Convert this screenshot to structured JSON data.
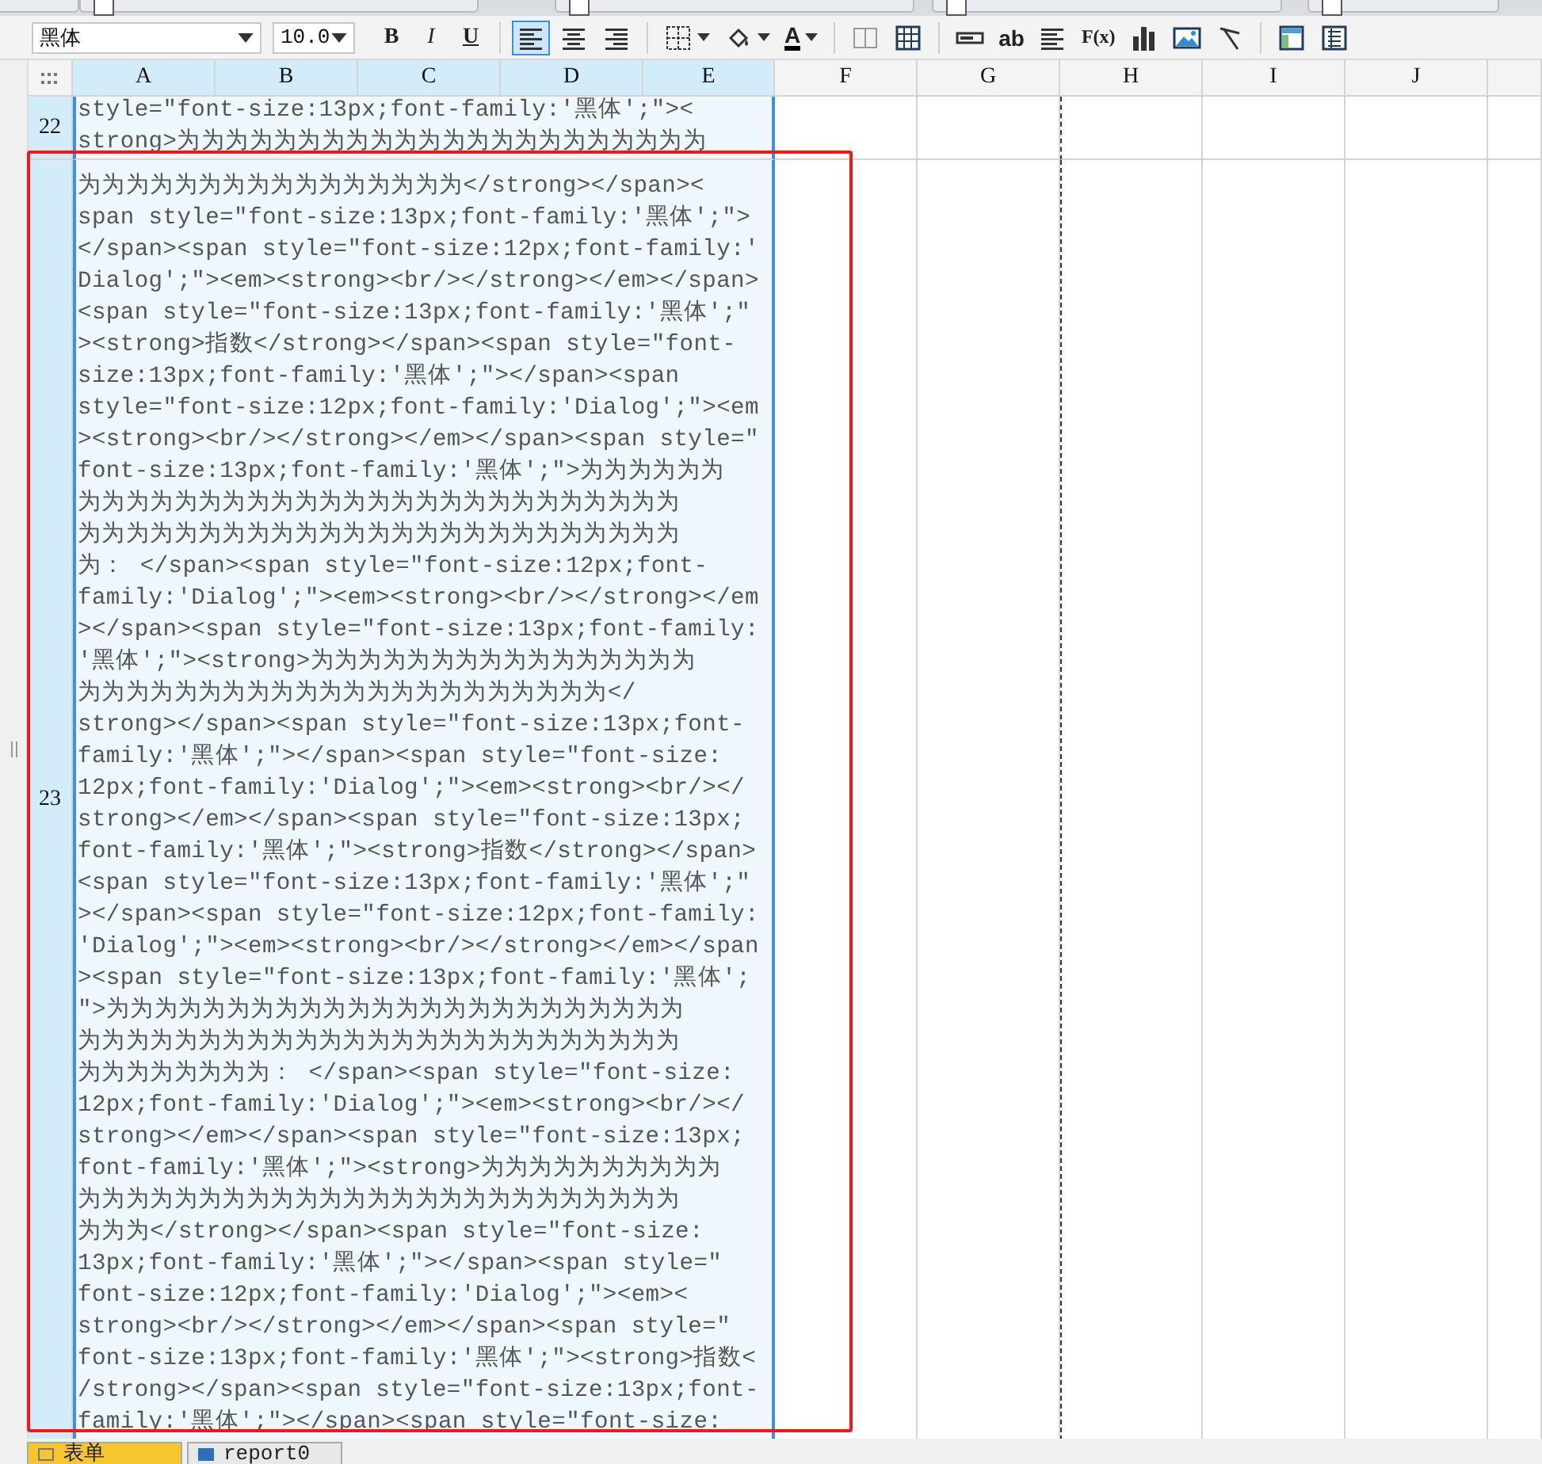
{
  "toolbar": {
    "font": "黑体",
    "size": "10.0",
    "buttons": [
      {
        "kind": "bold",
        "label": "B"
      },
      {
        "kind": "italic",
        "label": "I"
      },
      {
        "kind": "underline",
        "label": "U"
      },
      {
        "kind": "separator"
      },
      {
        "kind": "align-left",
        "selected": true
      },
      {
        "kind": "align-center",
        "selected": false
      },
      {
        "kind": "align-right",
        "selected": false
      },
      {
        "kind": "separator"
      },
      {
        "kind": "border"
      },
      {
        "kind": "fill-color"
      },
      {
        "kind": "font-color",
        "label": "A"
      },
      {
        "kind": "separator"
      },
      {
        "kind": "frame"
      },
      {
        "kind": "table"
      },
      {
        "kind": "separator"
      },
      {
        "kind": "textbox"
      },
      {
        "kind": "text-label",
        "label": "ab"
      },
      {
        "kind": "paragraph"
      },
      {
        "kind": "formula",
        "label": "F(x)"
      },
      {
        "kind": "bar-chart"
      },
      {
        "kind": "image"
      },
      {
        "kind": "slash"
      },
      {
        "kind": "separator"
      },
      {
        "kind": "form"
      },
      {
        "kind": "list-form"
      }
    ]
  },
  "sheet": {
    "columns": [
      {
        "label": "A",
        "selected": true
      },
      {
        "label": "B",
        "selected": true
      },
      {
        "label": "C",
        "selected": true
      },
      {
        "label": "D",
        "selected": true
      },
      {
        "label": "E",
        "selected": true
      },
      {
        "label": "F",
        "selected": false,
        "page_break": false
      },
      {
        "label": "G",
        "selected": false,
        "page_break": false
      },
      {
        "label": "H",
        "selected": false,
        "page_break": true
      },
      {
        "label": "I",
        "selected": false,
        "page_break": false
      },
      {
        "label": "J",
        "selected": false,
        "page_break": false
      }
    ],
    "rows": [
      {
        "number": "22",
        "selected": true,
        "lines": [
          "style=\"font-size:13px;font-family:'黑体';\"><",
          "strong>为为为为为为为为为为为为为为为为为为为为为为"
        ]
      },
      {
        "number": "23",
        "selected": true,
        "lines": [
          "为为为为为为为为为为为为为为为为</strong></span><",
          "span style=\"font-size:13px;font-family:'黑体';\">",
          "</span><span style=\"font-size:12px;font-family:'",
          "Dialog';\"><em><strong><br/></strong></em></span>",
          "<span style=\"font-size:13px;font-family:'黑体';\"",
          "><strong>指数</strong></span><span style=\"font-",
          "size:13px;font-family:'黑体';\"></span><span",
          "style=\"font-size:12px;font-family:'Dialog';\"><em",
          "><strong><br/></strong></em></span><span style=\"",
          "font-size:13px;font-family:'黑体';\">为为为为为为",
          "为为为为为为为为为为为为为为为为为为为为为为为为为",
          "为为为为为为为为为为为为为为为为为为为为为为为为为",
          "为： </span><span style=\"font-size:12px;font-",
          "family:'Dialog';\"><em><strong><br/></strong></em",
          "></span><span style=\"font-size:13px;font-family:",
          "'黑体';\"><strong>为为为为为为为为为为为为为为为为",
          "为为为为为为为为为为为为为为为为为为为为为为</",
          "strong></span><span style=\"font-size:13px;font-",
          "family:'黑体';\"></span><span style=\"font-size:",
          "12px;font-family:'Dialog';\"><em><strong><br/></",
          "strong></em></span><span style=\"font-size:13px;",
          "font-family:'黑体';\"><strong>指数</strong></span>",
          "<span style=\"font-size:13px;font-family:'黑体';\"",
          "></span><span style=\"font-size:12px;font-family:",
          "'Dialog';\"><em><strong><br/></strong></em></span",
          "><span style=\"font-size:13px;font-family:'黑体';",
          "\">为为为为为为为为为为为为为为为为为为为为为为为为",
          "为为为为为为为为为为为为为为为为为为为为为为为为为",
          "为为为为为为为为： </span><span style=\"font-size:",
          "12px;font-family:'Dialog';\"><em><strong><br/></",
          "strong></em></span><span style=\"font-size:13px;",
          "font-family:'黑体';\"><strong>为为为为为为为为为为",
          "为为为为为为为为为为为为为为为为为为为为为为为为为",
          "为为为</strong></span><span style=\"font-size:",
          "13px;font-family:'黑体';\"></span><span style=\"",
          "font-size:12px;font-family:'Dialog';\"><em><",
          "strong><br/></strong></em></span><span style=\"",
          "font-size:13px;font-family:'黑体';\"><strong>指数<",
          "/strong></span><span style=\"font-size:13px;font-",
          "family:'黑体';\"></span><span style=\"font-size:"
        ]
      }
    ]
  },
  "sheet_tabs": [
    {
      "label": "表单",
      "selected": true
    },
    {
      "label": "report0",
      "selected": false
    }
  ]
}
